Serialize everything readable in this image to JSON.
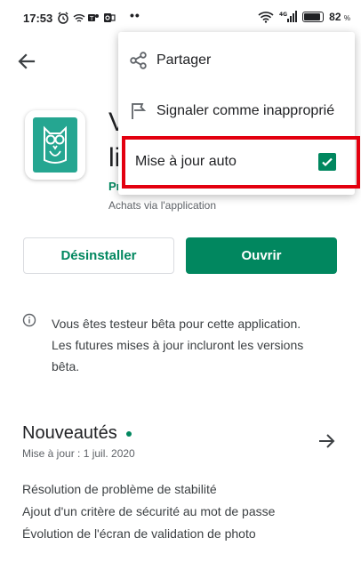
{
  "status_bar": {
    "time": "17:53",
    "battery_percent": "82",
    "battery_suffix": "%",
    "network": "4G"
  },
  "app": {
    "title_visible": "V",
    "title_visible_line2": "li",
    "developer_partial": "Pr",
    "purchase_info": "Achats via l'application"
  },
  "actions": {
    "uninstall_label": "Désinstaller",
    "open_label": "Ouvrir"
  },
  "beta_note": "Vous êtes testeur bêta pour cette application. Les futures mises à jour incluront les versions bêta.",
  "whats_new": {
    "title": "Nouveautés",
    "date": "Mise à jour : 1 juil. 2020",
    "lines": [
      "Résolution de problème de stabilité",
      "Ajout d'un critère de sécurité au mot de passe",
      "Évolution de l'écran de validation de photo"
    ]
  },
  "menu": {
    "items": [
      {
        "label": "Partager",
        "icon": "share-icon"
      },
      {
        "label": "Signaler comme inapproprié",
        "icon": "flag-icon"
      },
      {
        "label": "Mise à jour auto",
        "checked": true
      }
    ]
  },
  "colors": {
    "accent": "#01875f",
    "highlight": "#e3000f",
    "app_icon_bg": "#25a691"
  }
}
